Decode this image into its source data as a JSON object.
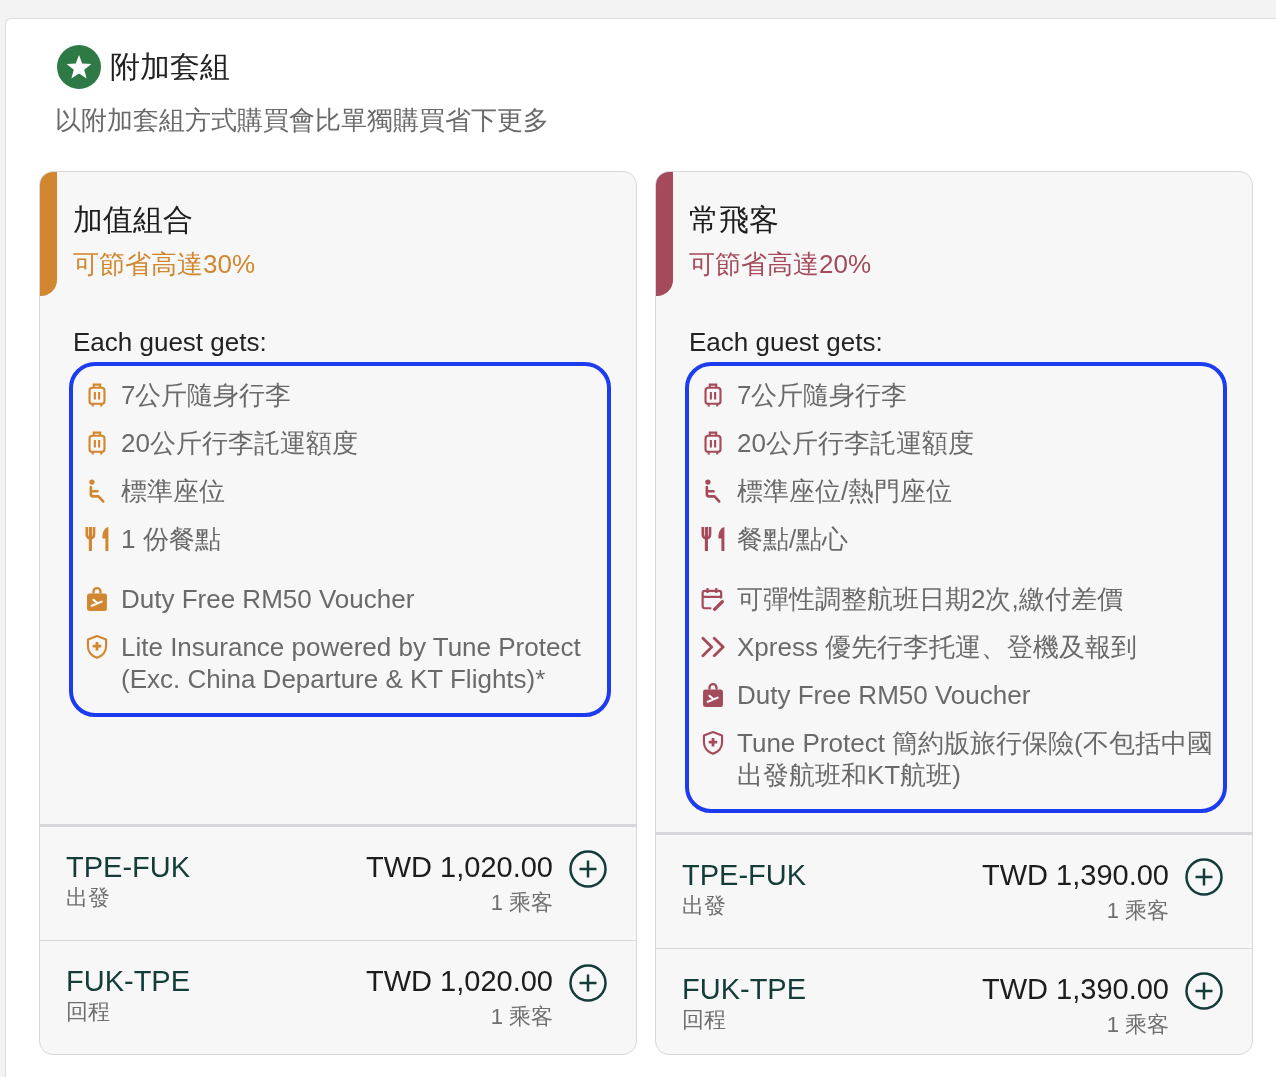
{
  "section": {
    "title": "附加套組",
    "subtitle": "以附加套組方式購買會比單獨購買省下更多"
  },
  "bundles": [
    {
      "title": "加值組合",
      "savings": "可節省高達30%",
      "color": "#d2862f",
      "benefits_heading": "Each guest gets:",
      "benefits_highlighted": true,
      "benefit_groups": [
        {
          "items": [
            {
              "kind": "cabin_bag",
              "text": "7公斤隨身行李"
            },
            {
              "kind": "checked_bag",
              "text": "20公斤行李託運額度"
            },
            {
              "kind": "seat",
              "text": "標準座位"
            },
            {
              "kind": "meal",
              "text": "1 份餐點"
            }
          ]
        },
        {
          "items": [
            {
              "kind": "voucher",
              "text": "Duty Free RM50 Voucher"
            },
            {
              "kind": "insurance",
              "text": "Lite Insurance powered by Tune Protect (Exc. China Departure & KT Flights)*"
            }
          ]
        }
      ],
      "routes": [
        {
          "route": "TPE-FUK",
          "direction": "出發",
          "price": "TWD 1,020.00",
          "passengers": "1 乘客"
        },
        {
          "route": "FUK-TPE",
          "direction": "回程",
          "price": "TWD 1,020.00",
          "passengers": "1 乘客"
        }
      ]
    },
    {
      "title": "常飛客",
      "savings": "可節省高達20%",
      "color": "#a44a5a",
      "benefits_heading": "Each guest gets:",
      "benefits_highlighted": true,
      "benefit_groups": [
        {
          "items": [
            {
              "kind": "cabin_bag",
              "text": "7公斤隨身行李"
            },
            {
              "kind": "checked_bag",
              "text": "20公斤行李託運額度"
            },
            {
              "kind": "seat",
              "text": "標準座位/熱門座位"
            },
            {
              "kind": "meal",
              "text": "餐點/點心"
            }
          ]
        },
        {
          "items": [
            {
              "kind": "flex",
              "text": "可彈性調整航班日期2次,繳付差價"
            },
            {
              "kind": "express",
              "text": "Xpress 優先行李托運、登機及報到"
            },
            {
              "kind": "voucher",
              "text": "Duty Free RM50 Voucher"
            },
            {
              "kind": "insurance",
              "text": "Tune Protect 簡約版旅行保險(不包括中國出發航班和KT航班)"
            }
          ]
        }
      ],
      "routes": [
        {
          "route": "TPE-FUK",
          "direction": "出發",
          "price": "TWD 1,390.00",
          "passengers": "1 乘客"
        },
        {
          "route": "FUK-TPE",
          "direction": "回程",
          "price": "TWD 1,390.00",
          "passengers": "1 乘客"
        }
      ]
    }
  ]
}
